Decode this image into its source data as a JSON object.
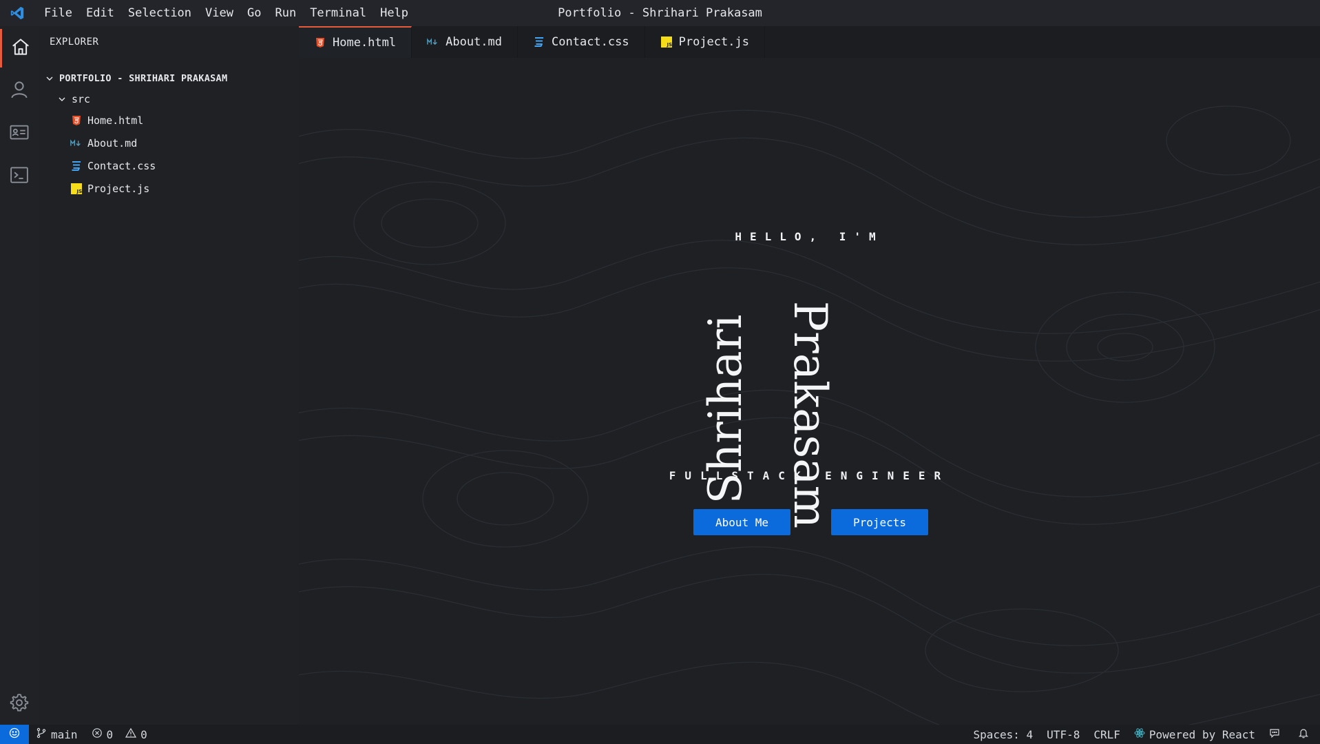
{
  "window": {
    "title": "Portfolio - Shrihari Prakasam",
    "app_icon": "vscode-logo-icon",
    "accent": "#0b6bdc",
    "active_tab_accent": "#e55b3c"
  },
  "menu": [
    "File",
    "Edit",
    "Selection",
    "View",
    "Go",
    "Run",
    "Terminal",
    "Help"
  ],
  "activity_bar": {
    "items": [
      {
        "icon": "home-icon",
        "active": true
      },
      {
        "icon": "user-icon",
        "active": false
      },
      {
        "icon": "contact-card-icon",
        "active": false
      },
      {
        "icon": "terminal-icon",
        "active": false
      }
    ],
    "bottom": {
      "icon": "gear-icon"
    }
  },
  "sidebar": {
    "title": "EXPLORER",
    "project": "PORTFOLIO - SHRIHARI PRAKASAM",
    "folder": "src",
    "files": [
      {
        "name": "Home.html",
        "icon": "html-icon",
        "color": "#e44d26"
      },
      {
        "name": "About.md",
        "icon": "markdown-icon",
        "color": "#519aba"
      },
      {
        "name": "Contact.css",
        "icon": "css-icon",
        "color": "#42a5f5"
      },
      {
        "name": "Project.js",
        "icon": "js-icon",
        "color": "#f5de19"
      }
    ]
  },
  "tabs": [
    {
      "label": "Home.html",
      "icon": "html-icon",
      "active": true
    },
    {
      "label": "About.md",
      "icon": "markdown-icon",
      "active": false
    },
    {
      "label": "Contact.css",
      "icon": "css-icon",
      "active": false
    },
    {
      "label": "Project.js",
      "icon": "js-icon",
      "active": false
    }
  ],
  "hero": {
    "greeting": "HELLO, I'M",
    "first_name": "Shrihari",
    "last_name": "Prakasam",
    "role": "FULLSTACK ENGINEER",
    "buttons": {
      "about": "About Me",
      "projects": "Projects"
    }
  },
  "status_bar": {
    "branch": "main",
    "errors": "0",
    "warnings": "0",
    "spaces": "Spaces: 4",
    "encoding": "UTF-8",
    "eol": "CRLF",
    "powered": "Powered by React"
  }
}
